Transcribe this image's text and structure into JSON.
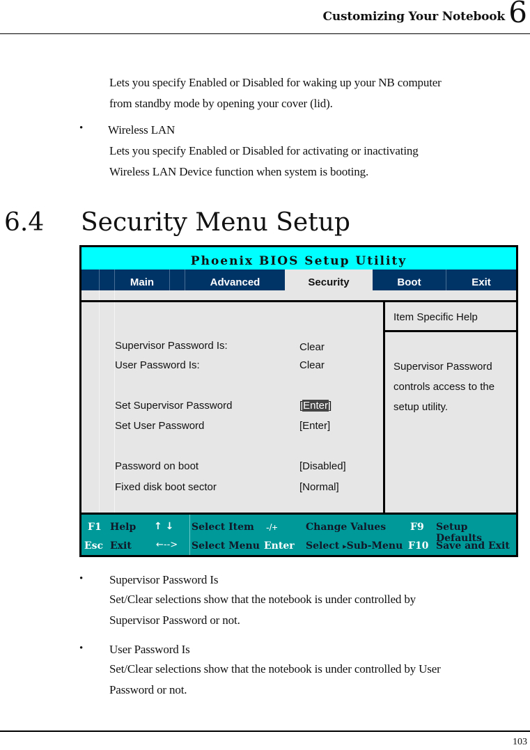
{
  "header": {
    "title": "Customizing Your Notebook",
    "chapter": "6"
  },
  "intro": {
    "lid_desc_line1": "Lets you specify Enabled or Disabled for waking up your NB computer",
    "lid_desc_line2": "from standby mode by opening your cover (lid).",
    "bullet_symbol": "•",
    "wireless_title": "Wireless LAN",
    "wireless_desc_line1": "Lets you specify Enabled or Disabled for activating or inactivating",
    "wireless_desc_line2": "Wireless LAN Device function when system is booting."
  },
  "section": {
    "number": "6.4",
    "title": "Security Menu Setup"
  },
  "bios": {
    "title": "Phoenix BIOS Setup Utility",
    "tabs": [
      {
        "label": "Main",
        "active": false
      },
      {
        "label": "Advanced",
        "active": false
      },
      {
        "label": "Security",
        "active": true
      },
      {
        "label": "Boot",
        "active": false
      },
      {
        "label": "Exit",
        "active": false
      }
    ],
    "items": [
      {
        "label": "Supervisor Password Is:",
        "value": "Clear"
      },
      {
        "label": "User Password Is:",
        "value": "Clear"
      },
      {
        "label": "Set Supervisor Password",
        "value_open": "[",
        "value": "Enter",
        "value_close": "]",
        "selected": true
      },
      {
        "label": "Set User Password",
        "value": "[Enter]"
      },
      {
        "label": "Password on boot",
        "value": "[Disabled]"
      },
      {
        "label": "Fixed disk boot sector",
        "value": "[Normal]"
      }
    ],
    "help": {
      "title": "Item Specific Help",
      "lines": [
        "Supervisor Password",
        "controls access to the",
        "setup utility."
      ]
    },
    "footer": {
      "row1": [
        {
          "key": "F1",
          "action": "Help"
        },
        {
          "key": "↑ ↓",
          "action": "Select Item"
        },
        {
          "key": "-/+",
          "action": "Change Values"
        },
        {
          "key": "F9",
          "action": "Setup Defaults"
        }
      ],
      "row2": [
        {
          "key": "Esc",
          "action": "Exit"
        },
        {
          "key": "←-->",
          "action": "Select Menu"
        },
        {
          "key": "Enter",
          "action": "Select",
          "action_arrow": "▸",
          "action_suffix": "Sub-Menu"
        },
        {
          "key": "F10",
          "action": "Save and Exit"
        }
      ]
    },
    "colors": {
      "title_bg": "#00ffff",
      "tab_bar_bg": "#003366",
      "panel_bg": "#e6e6e6",
      "footer_bg": "#009999"
    }
  },
  "descriptions": [
    {
      "title": "Supervisor Password Is",
      "line1": "Set/Clear selections show that the notebook is under controlled by",
      "line2": "Supervisor Password or not."
    },
    {
      "title": "User Password Is",
      "line1": "Set/Clear selections show that the notebook is under controlled by User",
      "line2": "Password or not."
    }
  ],
  "page_number": "103"
}
